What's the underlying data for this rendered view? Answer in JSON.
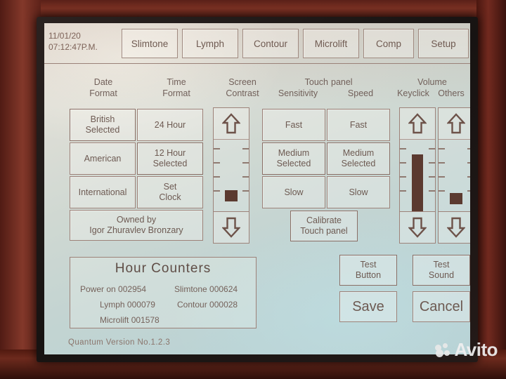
{
  "device": {
    "status_bar": {
      "date": "11/01/20",
      "time": "07:12:47P.M."
    },
    "version_label": "Quantum  Version  No.1.2.3"
  },
  "tabs": [
    {
      "label": "Slimtone"
    },
    {
      "label": "Lymph"
    },
    {
      "label": "Contour"
    },
    {
      "label": "Microlift"
    },
    {
      "label": "Comp"
    },
    {
      "label": "Setup"
    }
  ],
  "headers": {
    "date_format": {
      "line1": "Date",
      "line2": "Format"
    },
    "time_format": {
      "line1": "Time",
      "line2": "Format"
    },
    "screen_contrast": {
      "line1": "Screen",
      "line2": "Contrast"
    },
    "touch": {
      "line1": "Touch",
      "line2": "Sensitivity"
    },
    "panel": {
      "line1": "panel",
      "line2": "Speed"
    },
    "volume": {
      "line1": "Volume"
    },
    "keyclick": {
      "line2": "Keyclick"
    },
    "others": {
      "line2": "Others"
    }
  },
  "date_format": {
    "options": [
      {
        "label": "British",
        "state": "Selected"
      },
      {
        "label": "American",
        "state": ""
      },
      {
        "label": "International",
        "state": ""
      }
    ]
  },
  "time_format": {
    "options": [
      {
        "label": "24  Hour",
        "state": ""
      },
      {
        "label": "12  Hour",
        "state": "Selected"
      }
    ],
    "set_clock": {
      "line1": "Set",
      "line2": "Clock"
    }
  },
  "owner_banner": {
    "line1": "Owned  by",
    "line2": "Igor  Zhuravlev  Bronzary"
  },
  "touch_sensitivity": {
    "options": [
      {
        "label": "Fast",
        "state": ""
      },
      {
        "label": "Medium",
        "state": "Selected"
      },
      {
        "label": "Slow",
        "state": ""
      }
    ]
  },
  "panel_speed": {
    "options": [
      {
        "label": "Fast",
        "state": ""
      },
      {
        "label": "Medium",
        "state": "Selected"
      },
      {
        "label": "Slow",
        "state": ""
      }
    ]
  },
  "calibrate_button": {
    "line1": "Calibrate",
    "line2": "Touch  panel"
  },
  "sliders": {
    "contrast": {
      "name": "Screen Contrast",
      "level_percent": 16,
      "style": "block"
    },
    "keyclick": {
      "name": "Volume Keyclick",
      "level_percent": 78,
      "style": "bar"
    },
    "others": {
      "name": "Volume Others",
      "level_percent": 11,
      "style": "block"
    }
  },
  "hour_counters": {
    "title": "Hour   Counters",
    "entries": [
      {
        "label": "Power  on",
        "value": "002954"
      },
      {
        "label": "Slimtone",
        "value": "000624"
      },
      {
        "label": "Lymph",
        "value": "000079"
      },
      {
        "label": "Contour",
        "value": "000028"
      },
      {
        "label": "Microlift",
        "value": "001578"
      }
    ]
  },
  "actions": {
    "test_button": {
      "line1": "Test",
      "line2": "Button"
    },
    "test_sound": {
      "line1": "Test",
      "line2": "Sound"
    },
    "save": "Save",
    "cancel": "Cancel"
  },
  "watermark": {
    "text": "Avito"
  },
  "colors": {
    "bezel": "#241a18",
    "shell": "#7a3123",
    "lcd_bg": "#c9d6d2",
    "lcd_text": "#6d5a52",
    "lcd_border": "#9d8279",
    "slider_fill": "#5b3a30"
  }
}
